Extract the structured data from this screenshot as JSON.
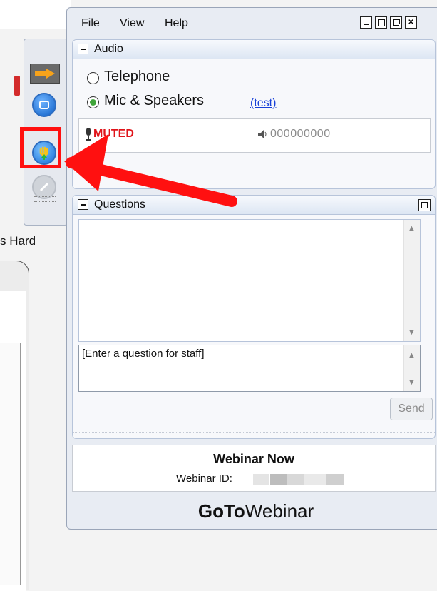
{
  "menu": {
    "file": "File",
    "view": "View",
    "help": "Help"
  },
  "window_controls": [
    "minimize-icon",
    "restore-icon",
    "popout-icon",
    "close-icon"
  ],
  "audio": {
    "title": "Audio",
    "options": [
      {
        "label": "Telephone",
        "selected": false
      },
      {
        "label": "Mic & Speakers",
        "selected": true
      }
    ],
    "test_link": "(test)",
    "status": "MUTED",
    "level": "000000000"
  },
  "questions": {
    "title": "Questions",
    "input_text": "[Enter a question for staff]",
    "send_label": "Send"
  },
  "webinar": {
    "title": "Webinar Now",
    "id_label": "Webinar ID:"
  },
  "brand": {
    "part1": "GoTo",
    "part2": "Webinar"
  },
  "background_app": {
    "text": "s Hard"
  },
  "toolbar": {
    "icons": [
      "arrow-icon",
      "screen-icon",
      "raise-hand-icon",
      "pencil-icon"
    ]
  },
  "colors": {
    "highlight": "#ff1010",
    "muted": "#e0141a",
    "link": "#1740d8"
  }
}
